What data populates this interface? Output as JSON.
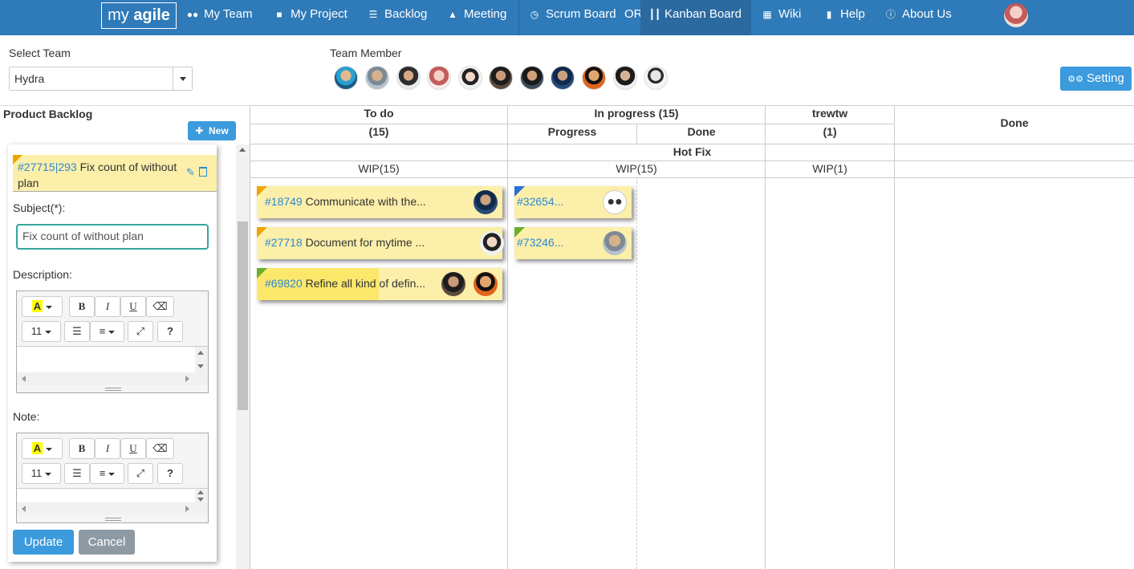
{
  "colors": {
    "nav_bg": "#2f7ab8",
    "primary_button": "#3b9bdc",
    "cancel_button": "#8e9aa3",
    "card_bg": "#fcefa9",
    "link": "#2c8ad3",
    "priority_orange": "#f0a500",
    "priority_green": "#69b02b",
    "priority_blue": "#2a6fd6",
    "input_focus": "#35a69c"
  },
  "nav": {
    "logo_prefix": "my ",
    "logo_bold": "agile",
    "items": [
      {
        "label": "My Team",
        "icon": "users-icon"
      },
      {
        "label": "My Project",
        "icon": "folder-icon"
      },
      {
        "label": "Backlog",
        "icon": "list-icon"
      },
      {
        "label": "Meeting",
        "icon": "sitemap-icon"
      },
      {
        "label": "Scrum Board",
        "icon": "clock-icon"
      },
      {
        "label": "OR",
        "icon": ""
      },
      {
        "label": "Kanban Board",
        "icon": "columns-icon"
      },
      {
        "label": "Wiki",
        "icon": "table-icon"
      },
      {
        "label": "Help",
        "icon": "book-icon"
      },
      {
        "label": "About Us",
        "icon": "info-icon"
      }
    ]
  },
  "team": {
    "select_label": "Select Team",
    "selected": "Hydra",
    "member_label": "Team Member"
  },
  "setting_label": "Setting",
  "backlog": {
    "title": "Product Backlog",
    "new_label": "New",
    "item_id": "#27715|293",
    "item_title": "Fix count of without plan",
    "subject_label": "Subject(*):",
    "subject_value": "Fix count of without plan",
    "description_label": "Description:",
    "note_label": "Note:",
    "font_size": "11",
    "bold": "B",
    "italic": "I",
    "underline": "U",
    "help": "?",
    "update_label": "Update",
    "cancel_label": "Cancel"
  },
  "board": {
    "columns": {
      "todo": {
        "title": "To do",
        "count": "(15)"
      },
      "inprogress": {
        "title": "In progress (15)",
        "sub_progress": "Progress",
        "sub_done": "Done"
      },
      "trewtw": {
        "title": "trewtw",
        "count": "(1)"
      },
      "done": {
        "title": "Done"
      }
    },
    "swimlane": "Hot Fix",
    "wip": {
      "todo": "WIP(15)",
      "inprogress": "WIP(15)",
      "trewtw": "WIP(1)"
    },
    "cards": [
      {
        "id": "#18749",
        "title": "Communicate with the...",
        "priority": "orange"
      },
      {
        "id": "#27718",
        "title": "Document for mytime ...",
        "priority": "orange"
      },
      {
        "id": "#69820",
        "title": "Refine all kind of defin...",
        "priority": "green"
      },
      {
        "id": "#32654...",
        "title": "",
        "priority": "blue"
      },
      {
        "id": "#73246...",
        "title": "",
        "priority": "green"
      }
    ]
  }
}
